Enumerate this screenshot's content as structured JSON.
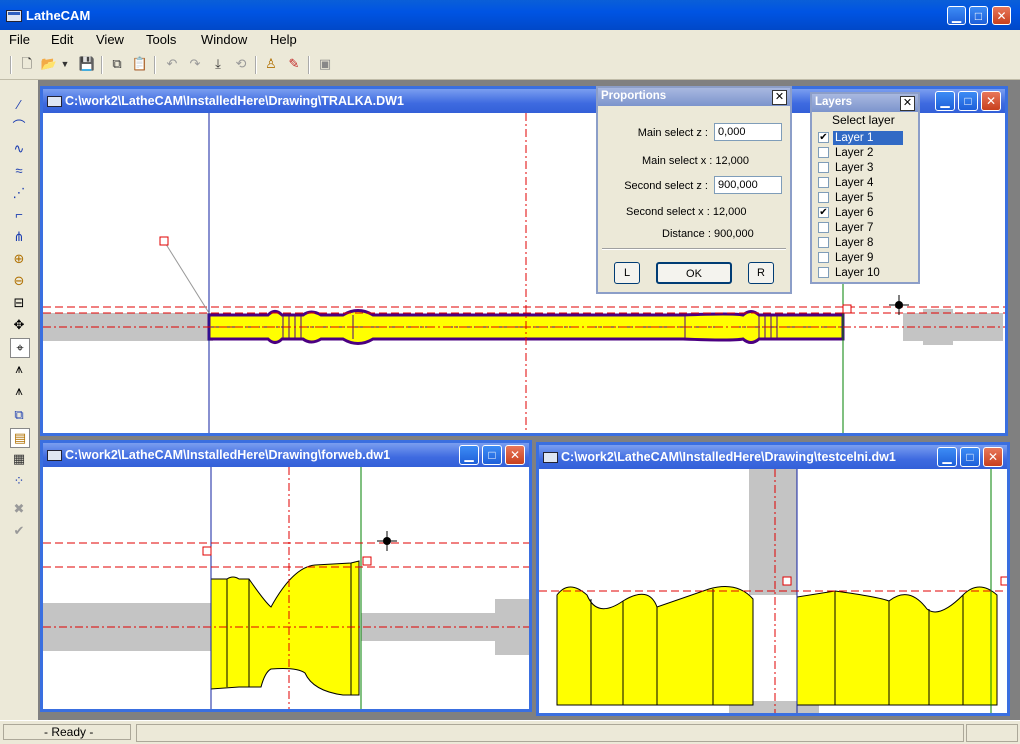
{
  "app": {
    "title": "LatheCAM"
  },
  "menu": [
    "File",
    "Edit",
    "View",
    "Tools",
    "Window",
    "Help"
  ],
  "toolbar": {
    "icons": [
      "new-file-icon",
      "open-file-icon",
      "dropdown-arrow-icon",
      "save-icon",
      "copy-icon",
      "paste-icon",
      "undo-icon",
      "redo-icon",
      "move-down-icon",
      "redo-alt-icon",
      "pin-icon",
      "tool-settings-icon",
      "print-icon"
    ]
  },
  "left_toolbar": {
    "icons": [
      "line-tool-icon",
      "arc-tool-icon",
      "curve-tool-icon",
      "spline-tool-icon",
      "polyline-tool-icon",
      "corner-tool-icon",
      "branch-tool-icon",
      "zoom-in-icon",
      "zoom-out-icon",
      "fit-view-icon",
      "pan-icon",
      "snap-icon",
      "tool-path-icon",
      "tool-path-alt-icon",
      "copy-doc-icon",
      "layer-tool-icon",
      "properties-icon",
      "points-icon",
      "cancel-icon",
      "confirm-icon"
    ]
  },
  "windows": {
    "main": {
      "title": "C:\\work2\\LatheCAM\\InstalledHere\\Drawing\\TRALKA.DW1"
    },
    "second": {
      "title": "C:\\work2\\LatheCAM\\InstalledHere\\Drawing\\forweb.dw1"
    },
    "third": {
      "title": "C:\\work2\\LatheCAM\\InstalledHere\\Drawing\\testcelni.dw1"
    }
  },
  "proportions": {
    "title": "Proportions",
    "main_z_label": "Main select z :",
    "main_z_value": "0,000",
    "main_x_text": "Main select x : 12,000",
    "second_z_label": "Second select z :",
    "second_z_value": "900,000",
    "second_x_text": "Second select x : 12,000",
    "distance_text": "Distance : 900,000",
    "btn_l": "L",
    "btn_ok": "OK",
    "btn_r": "R"
  },
  "layers": {
    "title": "Layers",
    "header": "Select layer",
    "items": [
      {
        "name": "Layer 1",
        "checked": true,
        "selected": true
      },
      {
        "name": "Layer 2",
        "checked": false
      },
      {
        "name": "Layer 3",
        "checked": false
      },
      {
        "name": "Layer 4",
        "checked": false
      },
      {
        "name": "Layer 5",
        "checked": false
      },
      {
        "name": "Layer 6",
        "checked": true
      },
      {
        "name": "Layer 7",
        "checked": false
      },
      {
        "name": "Layer 8",
        "checked": false
      },
      {
        "name": "Layer 9",
        "checked": false
      },
      {
        "name": "Layer 10",
        "checked": false
      }
    ]
  },
  "status": {
    "text": "- Ready -"
  },
  "colors": {
    "part_fill": "#ffff00",
    "part_outline": "#4b0082",
    "stock": "#c4c4c4",
    "guide_red": "#e00000"
  }
}
